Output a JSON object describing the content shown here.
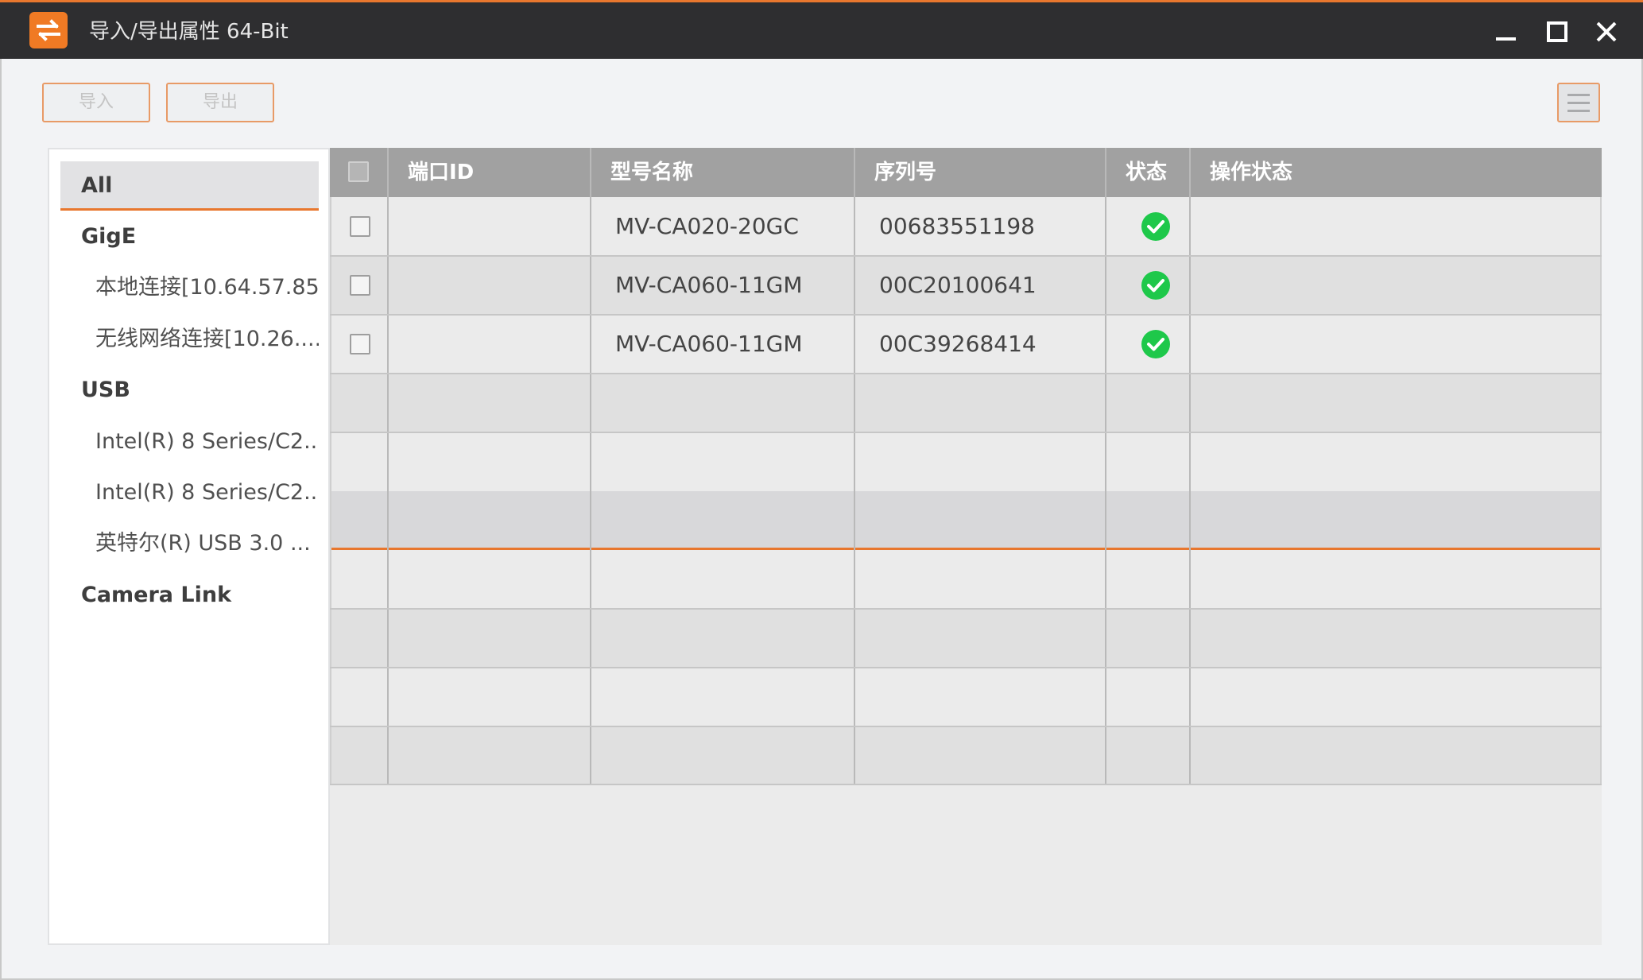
{
  "window": {
    "title": "导入/导出属性 64-Bit",
    "accent": "#e8772e",
    "icon": "swap-arrows-icon"
  },
  "toolbar": {
    "import_label": "导入",
    "export_label": "导出",
    "menu_icon": "hamburger-menu-icon"
  },
  "sidebar": {
    "items": [
      {
        "label": "All",
        "kind": "category",
        "selected": true
      },
      {
        "label": "GigE",
        "kind": "category"
      },
      {
        "label": "本地连接[10.64.57.85]",
        "kind": "interface"
      },
      {
        "label": "无线网络连接[10.26....",
        "kind": "interface"
      },
      {
        "label": "USB",
        "kind": "category"
      },
      {
        "label": "Intel(R) 8 Series/C2...",
        "kind": "interface"
      },
      {
        "label": "Intel(R) 8 Series/C2...",
        "kind": "interface"
      },
      {
        "label": "英特尔(R) USB 3.0 ...",
        "kind": "interface"
      },
      {
        "label": "Camera Link",
        "kind": "category"
      }
    ]
  },
  "grid": {
    "columns": [
      "端口ID",
      "型号名称",
      "序列号",
      "状态",
      "操作状态"
    ],
    "rows": [
      {
        "port_id": "",
        "model": "MV-CA020-20GC",
        "serial": "00683551198",
        "status": "ok",
        "op_status": ""
      },
      {
        "port_id": "",
        "model": "MV-CA060-11GM",
        "serial": "00C20100641",
        "status": "ok",
        "op_status": ""
      },
      {
        "port_id": "",
        "model": "MV-CA060-11GM",
        "serial": "00C39268414",
        "status": "ok",
        "op_status": ""
      }
    ],
    "status_color": "#1ec84a"
  }
}
